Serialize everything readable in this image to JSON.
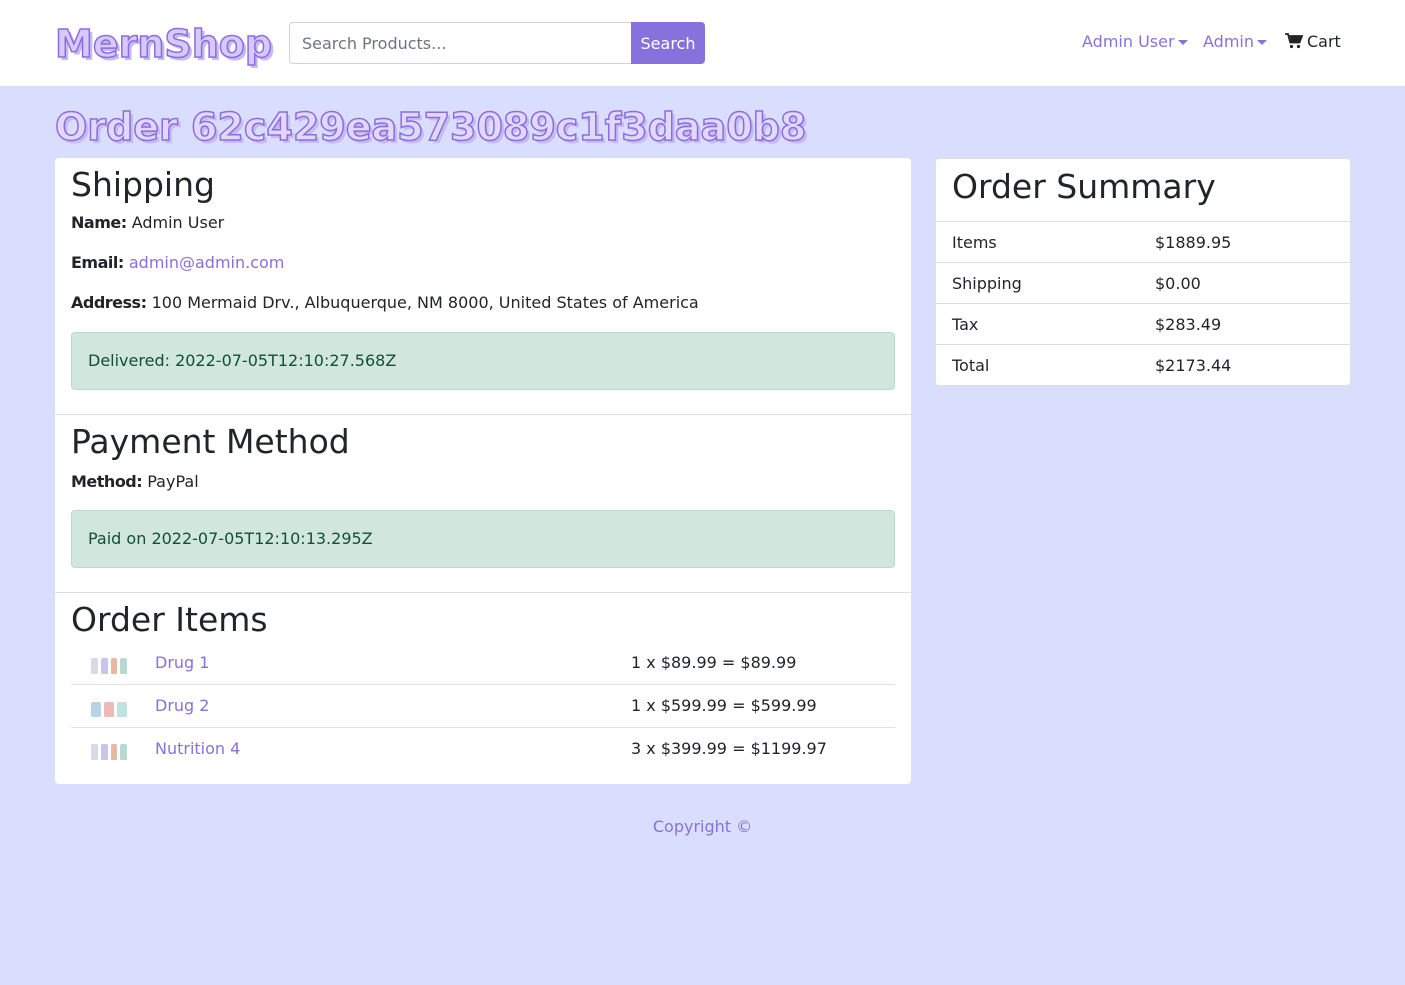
{
  "header": {
    "brand": "MernShop",
    "search_placeholder": "Search Products...",
    "search_button": "Search",
    "user_menu": "Admin User",
    "admin_menu": "Admin",
    "cart_label": "Cart"
  },
  "page": {
    "title": "Order 62c429ea573089c1f3daa0b8"
  },
  "shipping": {
    "title": "Shipping",
    "name_label": "Name:",
    "name_value": "Admin User",
    "email_label": "Email:",
    "email_value": "admin@admin.com",
    "address_label": "Address:",
    "address_value": "100 Mermaid Drv., Albuquerque, NM 8000, United States of America",
    "status": "Delivered: 2022-07-05T12:10:27.568Z"
  },
  "payment": {
    "title": "Payment Method",
    "method_label": "Method:",
    "method_value": "PayPal",
    "status": "Paid on 2022-07-05T12:10:13.295Z"
  },
  "order_items": {
    "title": "Order Items",
    "items": [
      {
        "name": "Drug 1",
        "price": "1 x $89.99 = $89.99",
        "thumb_colors": [
          "#d6dbe6",
          "#c9c4ea",
          "#e8b9a2",
          "#b9d8cf"
        ]
      },
      {
        "name": "Drug 2",
        "price": "1 x $599.99 = $599.99",
        "thumb_colors": [
          "#b8d3e4",
          "#efb9b6",
          "#bfe3e0"
        ]
      },
      {
        "name": "Nutrition 4",
        "price": "3 x $399.99 = $1199.97",
        "thumb_colors": [
          "#d6dbe6",
          "#c9c4ea",
          "#e8b9a2",
          "#b9d8cf"
        ]
      }
    ]
  },
  "summary": {
    "title": "Order Summary",
    "rows": [
      {
        "label": "Items",
        "value": "$1889.95"
      },
      {
        "label": "Shipping",
        "value": "$0.00"
      },
      {
        "label": "Tax",
        "value": "$283.49"
      },
      {
        "label": "Total",
        "value": "$2173.44"
      }
    ]
  },
  "footer": {
    "copyright": "Copyright ©"
  },
  "colors": {
    "accent": "#8572dc",
    "page_background": "#dadefe",
    "success_background": "#d1e7dd",
    "success_text": "#0f5132"
  }
}
